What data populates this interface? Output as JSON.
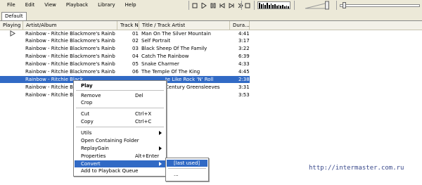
{
  "menu": [
    "File",
    "Edit",
    "View",
    "Playback",
    "Library",
    "Help"
  ],
  "playlist_tab": "Default",
  "columns": [
    "Playing",
    "Artist/Album",
    "Track No",
    "Title / Track Artist",
    "Dura..."
  ],
  "tracks": [
    {
      "artist": "Rainbow - Ritchie Blackmore's Rainbow",
      "no": "01",
      "title": "Man On The Silver Mountain",
      "duration": "4:41"
    },
    {
      "artist": "Rainbow - Ritchie Blackmore's Rainbow",
      "no": "02",
      "title": "Self Portrait",
      "duration": "3:17"
    },
    {
      "artist": "Rainbow - Ritchie Blackmore's Rainbow",
      "no": "03",
      "title": "Black Sheep Of The Family",
      "duration": "3:22"
    },
    {
      "artist": "Rainbow - Ritchie Blackmore's Rainbow",
      "no": "04",
      "title": "Catch The Rainbow",
      "duration": "6:39"
    },
    {
      "artist": "Rainbow - Ritchie Blackmore's Rainbow",
      "no": "05",
      "title": "Snake Charmer",
      "duration": "4:33"
    },
    {
      "artist": "Rainbow - Ritchie Blackmore's Rainbow",
      "no": "06",
      "title": "The Temple Of The King",
      "duration": "4:45"
    },
    {
      "artist": "Rainbow - Ritchie Black",
      "no": "",
      "title": "te Like Rock 'N' Roll",
      "duration": "2:38"
    },
    {
      "artist": "Rainbow - Ritchie Black",
      "no": "",
      "title": "Century Greensleeves",
      "duration": "3:31"
    },
    {
      "artist": "Rainbow - Ritchie Black",
      "no": "",
      "title": "",
      "duration": "3:53"
    }
  ],
  "context_menu": {
    "play": "Play",
    "remove": "Remove",
    "remove_shortcut": "Del",
    "crop": "Crop",
    "cut": "Cut",
    "cut_shortcut": "Ctrl+X",
    "copy": "Copy",
    "copy_shortcut": "Ctrl+C",
    "utils": "Utils",
    "open_folder": "Open Containing Folder",
    "replaygain": "ReplayGain",
    "properties": "Properties",
    "properties_shortcut": "Alt+Enter",
    "convert": "Convert",
    "add_queue": "Add to Playback Queue"
  },
  "submenu": {
    "last_used": "[last used]",
    "more": "..."
  },
  "watermark": "http://intermaster.com.ru",
  "spectrum_levels": [
    0.9,
    0.7,
    0.8,
    0.55,
    0.85,
    0.6,
    0.75,
    0.5,
    0.65,
    0.45,
    0.55,
    0.4,
    0.5,
    0.35,
    0.45,
    0.3
  ],
  "volume_level": 0.95,
  "seek_position": 0.0,
  "colors": {
    "selection": "#316ac5",
    "toolbar": "#ece9d8"
  }
}
